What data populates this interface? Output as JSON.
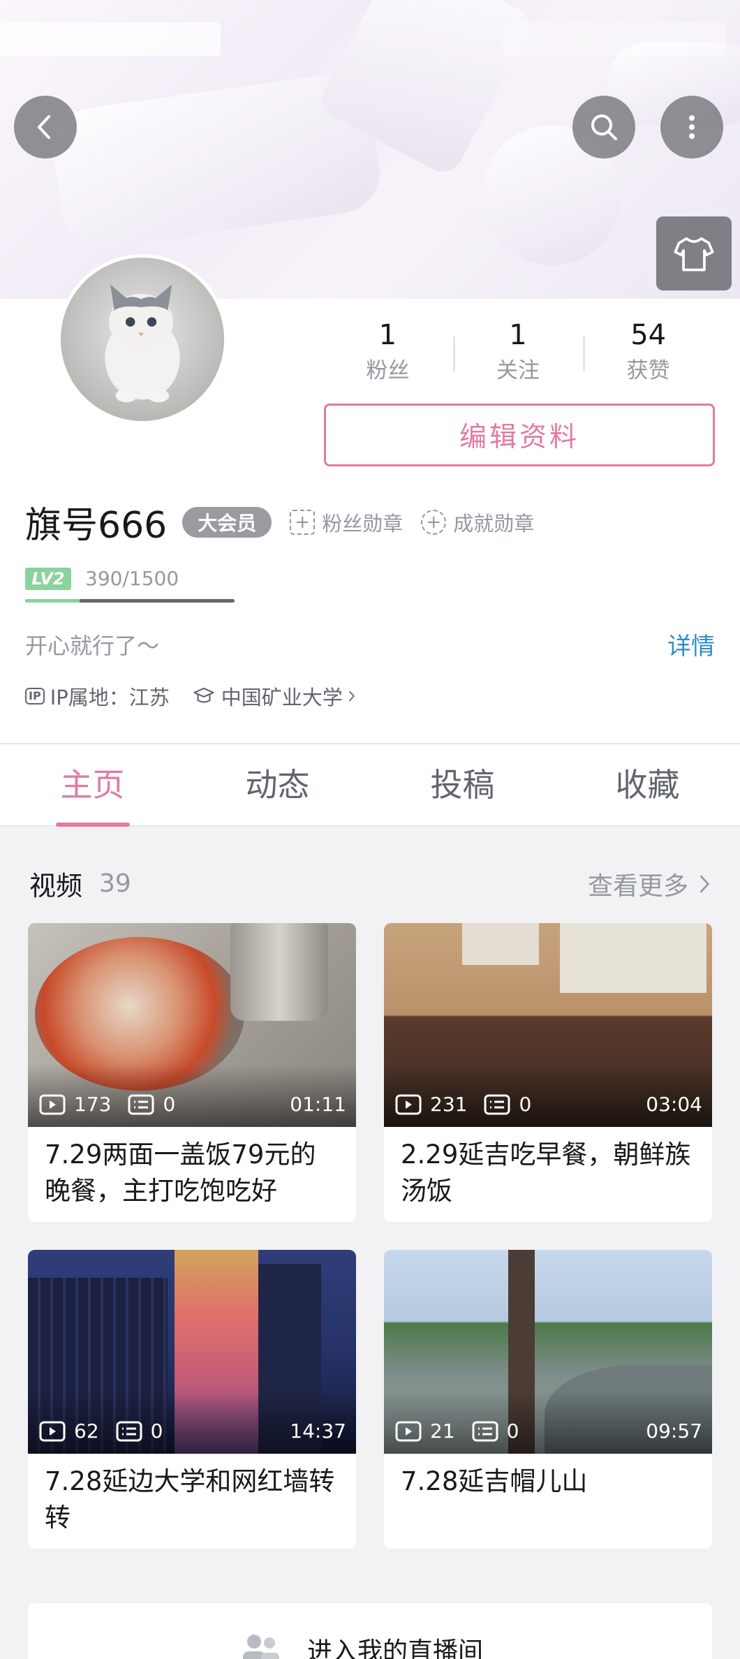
{
  "profile": {
    "fans_count": "1",
    "fans_label": "粉丝",
    "following_count": "1",
    "following_label": "关注",
    "likes_count": "54",
    "likes_label": "获赞",
    "edit_label": "编辑资料",
    "name": "旗号666",
    "vip_label": "大会员",
    "fan_medal_label": "粉丝勋章",
    "achievement_label": "成就勋章",
    "level_badge": "LV2",
    "level_progress_text": "390/1500",
    "level_progress_fraction": 0.26,
    "signature": "开心就行了～",
    "detail_label": "详情",
    "ip_tag": "IP",
    "ip_location": "IP属地：江苏",
    "school": "中国矿业大学"
  },
  "tabs": [
    {
      "label": "主页",
      "active": true
    },
    {
      "label": "动态",
      "active": false
    },
    {
      "label": "投稿",
      "active": false
    },
    {
      "label": "收藏",
      "active": false
    }
  ],
  "videos_section": {
    "title": "视频",
    "count": "39",
    "more_label": "查看更多"
  },
  "videos": [
    {
      "views": "173",
      "comments": "0",
      "duration": "01:11",
      "title": "7.29两面一盖饭79元的晚餐，主打吃饱吃好"
    },
    {
      "views": "231",
      "comments": "0",
      "duration": "03:04",
      "title": "2.29延吉吃早餐，朝鲜族汤饭"
    },
    {
      "views": "62",
      "comments": "0",
      "duration": "14:37",
      "title": "7.28延边大学和网红墙转转"
    },
    {
      "views": "21",
      "comments": "0",
      "duration": "09:57",
      "title": "7.28延吉帽儿山"
    }
  ],
  "live": {
    "label": "进入我的直播间"
  },
  "colors": {
    "accent": "#e37aa1",
    "link": "#2e8ec5",
    "level": "#8bd29c"
  },
  "icons": [
    "back-icon",
    "search-icon",
    "more-icon",
    "shirt-icon",
    "play-icon",
    "comment-icon",
    "chevron-right-icon",
    "graduation-cap-icon",
    "people-icon"
  ]
}
